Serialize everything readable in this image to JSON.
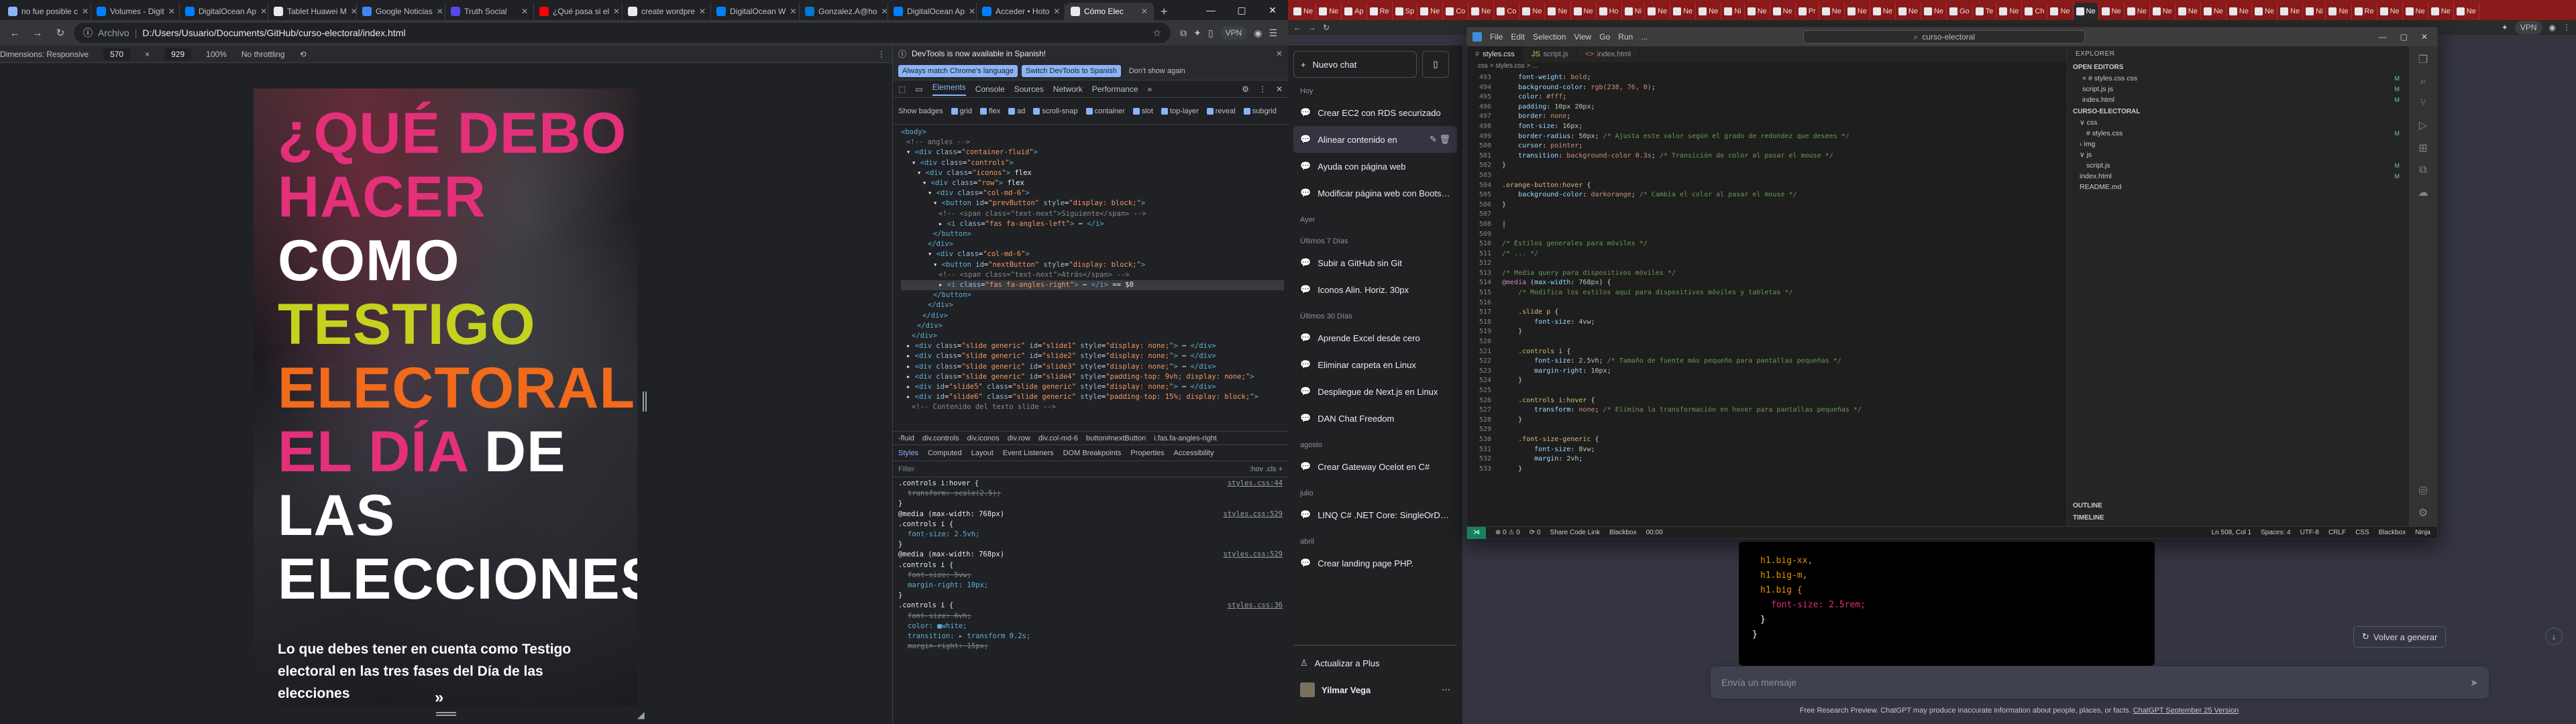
{
  "left_browser": {
    "tabs": [
      {
        "title": "no fue posible c",
        "color": "#8ab4f8"
      },
      {
        "title": "Volumes - Digit",
        "color": "#0080ff"
      },
      {
        "title": "DigitalOcean Ap",
        "color": "#0080ff"
      },
      {
        "title": "Tablet Huawei M",
        "color": "#e8eaed"
      },
      {
        "title": "Google Noticias",
        "color": "#4285f4"
      },
      {
        "title": "Truth Social",
        "color": "#5448ee"
      },
      {
        "title": "¿Qué pasa si el",
        "color": "#ff0000"
      },
      {
        "title": "create wordpre",
        "color": "#e8eaed"
      },
      {
        "title": "DigitalOcean W",
        "color": "#0080ff"
      },
      {
        "title": "Gonzalez.A@ho",
        "color": "#0078d4"
      },
      {
        "title": "DigitalOcean Ap",
        "color": "#0080ff"
      },
      {
        "title": "Acceder • Hoto",
        "color": "#0080ff"
      },
      {
        "title": "Cómo Elec",
        "color": "#e8eaed",
        "active": true
      }
    ],
    "address_prefix": "Archivo",
    "address": "D:/Users/Usuario/Documents/GitHub/curso-electoral/index.html",
    "vpn": "VPN",
    "device_toolbar": {
      "dimensions": "Dimensions: Responsive",
      "width": "570",
      "x": "×",
      "height": "929",
      "zoom": "100%",
      "throttle": "No throttling"
    },
    "page": {
      "headline": [
        {
          "text": "¿QUÉ DEBO",
          "color": "pink"
        },
        {
          "text": "HACER",
          "color": "pink"
        },
        {
          "text": "COMO",
          "color": "white"
        },
        {
          "text": "TESTIGO",
          "color": "lime"
        },
        {
          "text": "ELECTORAL",
          "color": "orange"
        },
        {
          "text_a": "EL DÍA",
          "text_b": " DE",
          "color": "mixed"
        },
        {
          "text": "LAS",
          "color": "white"
        },
        {
          "text": "ELECCIONES",
          "color": "white"
        }
      ],
      "subtitle": "Lo que debes tener en cuenta como Testigo electoral en las tres fases del Día de las elecciones",
      "next_arrow": "»"
    },
    "devtools": {
      "info": "DevTools is now available in Spanish!",
      "btn_always": "Always match Chrome's language",
      "btn_switch": "Switch DevTools to Spanish",
      "btn_dont": "Don't show again",
      "tabs": [
        "Elements",
        "Console",
        "Sources",
        "Network",
        "Performance",
        "»"
      ],
      "badges_label": "Show badges",
      "badges": [
        "grid",
        "flex",
        "ad",
        "scroll-snap",
        "container",
        "slot",
        "top-layer",
        "reveal",
        "subgrid"
      ],
      "dom_lines": [
        {
          "indent": 0,
          "html": "<span class='tag'>&lt;body&gt;</span>"
        },
        {
          "indent": 1,
          "html": "<span class='cmt'>&lt;!-- angles --&gt;</span>"
        },
        {
          "indent": 1,
          "html": "▾ <span class='tag'>&lt;div</span> <span class='attr'>class</span>=<span class='val'>\"container-fluid\"</span><span class='tag'>&gt;</span>"
        },
        {
          "indent": 2,
          "html": "▾ <span class='tag'>&lt;div</span> <span class='attr'>class</span>=<span class='val'>\"controls\"</span><span class='tag'>&gt;</span>"
        },
        {
          "indent": 3,
          "html": "▾ <span class='tag'>&lt;div</span> <span class='attr'>class</span>=<span class='val'>\"iconos\"</span><span class='tag'>&gt;</span> flex"
        },
        {
          "indent": 4,
          "html": "▾ <span class='tag'>&lt;div</span> <span class='attr'>class</span>=<span class='val'>\"row\"</span><span class='tag'>&gt;</span> flex"
        },
        {
          "indent": 5,
          "html": "▾ <span class='tag'>&lt;div</span> <span class='attr'>class</span>=<span class='val'>\"col-md-6\"</span><span class='tag'>&gt;</span>"
        },
        {
          "indent": 6,
          "html": "▾ <span class='tag'>&lt;button</span> <span class='attr'>id</span>=<span class='val'>\"prevButton\"</span> <span class='attr'>style</span>=<span class='val'>\"display: block;\"</span><span class='tag'>&gt;</span>"
        },
        {
          "indent": 7,
          "html": "<span class='cmt'>&lt;!-- &lt;span class=\"text-next\"&gt;Siguiente&lt;/span&gt; --&gt;</span>"
        },
        {
          "indent": 7,
          "html": "▸ <span class='tag'>&lt;i</span> <span class='attr'>class</span>=<span class='val'>\"fas fa-angles-left\"</span><span class='tag'>&gt;</span> ⋯ <span class='tag'>&lt;/i&gt;</span>"
        },
        {
          "indent": 6,
          "html": "<span class='tag'>&lt;/button&gt;</span>"
        },
        {
          "indent": 5,
          "html": "<span class='tag'>&lt;/div&gt;</span>"
        },
        {
          "indent": 5,
          "html": "▾ <span class='tag'>&lt;div</span> <span class='attr'>class</span>=<span class='val'>\"col-md-6\"</span><span class='tag'>&gt;</span>"
        },
        {
          "indent": 6,
          "html": "▾ <span class='tag'>&lt;button</span> <span class='attr'>id</span>=<span class='val'>\"nextButton\"</span> <span class='attr'>style</span>=<span class='val'>\"display: block;\"</span><span class='tag'>&gt;</span>"
        },
        {
          "indent": 7,
          "html": "<span class='cmt'>&lt;!-- &lt;span class=\"text-next\"&gt;Atrás&lt;/span&gt; --&gt;</span>"
        },
        {
          "indent": 7,
          "html": "▸ <span class='tag'>&lt;i</span> <span class='attr'>class</span>=<span class='val'>\"fas fa-angles-right\"</span><span class='tag'>&gt;</span> ⋯ <span class='tag'>&lt;/i&gt;</span> == $0",
          "sel": true
        },
        {
          "indent": 6,
          "html": "<span class='tag'>&lt;/button&gt;</span>"
        },
        {
          "indent": 5,
          "html": "<span class='tag'>&lt;/div&gt;</span>"
        },
        {
          "indent": 4,
          "html": "<span class='tag'>&lt;/div&gt;</span>"
        },
        {
          "indent": 3,
          "html": "<span class='tag'>&lt;/div&gt;</span>"
        },
        {
          "indent": 2,
          "html": "<span class='tag'>&lt;/div&gt;</span>"
        },
        {
          "indent": 1,
          "html": "▸ <span class='tag'>&lt;div</span> <span class='attr'>class</span>=<span class='val'>\"slide generic\"</span> <span class='attr'>id</span>=<span class='val'>\"slide1\"</span> <span class='attr'>style</span>=<span class='val'>\"display: none;\"</span><span class='tag'>&gt;</span> ⋯ <span class='tag'>&lt;/div&gt;</span>"
        },
        {
          "indent": 1,
          "html": "▸ <span class='tag'>&lt;div</span> <span class='attr'>class</span>=<span class='val'>\"slide generic\"</span> <span class='attr'>id</span>=<span class='val'>\"slide2\"</span> <span class='attr'>style</span>=<span class='val'>\"display: none;\"</span><span class='tag'>&gt;</span> ⋯ <span class='tag'>&lt;/div&gt;</span>"
        },
        {
          "indent": 1,
          "html": "▸ <span class='tag'>&lt;div</span> <span class='attr'>class</span>=<span class='val'>\"slide generic\"</span> <span class='attr'>id</span>=<span class='val'>\"slide3\"</span> <span class='attr'>style</span>=<span class='val'>\"display: none;\"</span><span class='tag'>&gt;</span> ⋯ <span class='tag'>&lt;/div&gt;</span>"
        },
        {
          "indent": 1,
          "html": "▸ <span class='tag'>&lt;div</span> <span class='attr'>class</span>=<span class='val'>\"slide generic\"</span> <span class='attr'>id</span>=<span class='val'>\"slide4\"</span> <span class='attr'>style</span>=<span class='val'>\"padding-top: 9vh; display: none;\"</span><span class='tag'>&gt;</span>"
        },
        {
          "indent": 1,
          "html": "▸ <span class='tag'>&lt;div</span> <span class='attr'>id</span>=<span class='val'>\"slide5\"</span> <span class='attr'>class</span>=<span class='val'>\"slide generic\"</span> <span class='attr'>style</span>=<span class='val'>\"display: none;\"</span><span class='tag'>&gt;</span> ⋯ <span class='tag'>&lt;/div&gt;</span>"
        },
        {
          "indent": 1,
          "html": "▸ <span class='tag'>&lt;div</span> <span class='attr'>id</span>=<span class='val'>\"slide6\"</span> <span class='attr'>class</span>=<span class='val'>\"slide generic\"</span> <span class='attr'>style</span>=<span class='val'>\"padding-top: 15%; display: block;\"</span><span class='tag'>&gt;</span>"
        },
        {
          "indent": 2,
          "html": "<span class='cmt'>&lt;!-- Contenido del texto slide --&gt;</span>"
        }
      ],
      "breadcrumb": [
        "-fluid",
        "div.controls",
        "div.iconos",
        "div.row",
        "div.col-md-6",
        "button#nextButton",
        "i.fas.fa-angles-right"
      ],
      "style_tabs": [
        "Styles",
        "Computed",
        "Layout",
        "Event Listeners",
        "DOM Breakpoints",
        "Properties",
        "Accessibility"
      ],
      "filter_placeholder": "Filter",
      "filter_tools": ":hov  .cls  +",
      "style_rules": [
        {
          "sel": ".controls i:hover {",
          "src": "styles.css:44"
        },
        {
          "decl": "transform: scale(2.5);",
          "strike": true
        },
        {
          "close": "}"
        },
        {
          "sel": "@media (max-width: 768px)",
          "src": "styles.css:529"
        },
        {
          "sel": ".controls i {",
          "src": ""
        },
        {
          "decl": "font-size: 2.5vh;",
          "strike": false
        },
        {
          "close": "}"
        },
        {
          "sel": "@media (max-width: 768px)",
          "src": "styles.css:529"
        },
        {
          "sel": ".controls i {",
          "src": ""
        },
        {
          "decl": "font-size: 5vw;",
          "strike": true
        },
        {
          "decl": "margin-right: 10px;",
          "strike": false
        },
        {
          "close": "}"
        },
        {
          "sel": ".controls i {",
          "src": "styles.css:36"
        },
        {
          "decl": "font-size: 6vh;",
          "strike": true
        },
        {
          "decl": "color: ■white;",
          "strike": false
        },
        {
          "decl": "transition: ▸ transform 0.2s;",
          "strike": false
        },
        {
          "decl": "margin-right: 15px;",
          "strike": true
        }
      ]
    }
  },
  "right_browser": {
    "tab_labels": [
      "Ne",
      "Ne",
      "Ap",
      "Re",
      "Sp",
      "Ne",
      "Co",
      "Ne",
      "Co",
      "Ne",
      "Ne",
      "Ne",
      "Ho",
      "Ni",
      "Ne",
      "Ne",
      "Ne",
      "Ni",
      "Ne",
      "Ne",
      "Pr",
      "Ne",
      "Ne",
      "Ne",
      "Ne",
      "Ne",
      "Go",
      "Te",
      "Ne",
      "Ch",
      "Ne",
      "Ne",
      "Ne",
      "Ne",
      "Ne",
      "Ne",
      "Ne",
      "Ne",
      "Ne",
      "Ne",
      "Ni",
      "Ne",
      "Re",
      "Ne",
      "Ne",
      "Ne",
      "Ne"
    ],
    "vpn": "VPN",
    "chatgpt": {
      "new_chat": "Nuevo chat",
      "groups": [
        {
          "label": "Hoy",
          "items": [
            "Crear EC2 con RDS securizado",
            "Alinear contenido en",
            "Ayuda con página web",
            "Modificar página web con Bootstrap"
          ]
        },
        {
          "label": "Ayer",
          "items": []
        },
        {
          "label": "Últimos 7 Días",
          "items": [
            "Subir a GitHub sin Git",
            "Iconos Alin. Horiz. 30px"
          ]
        },
        {
          "label": "Últimos 30 Días",
          "items": [
            "Aprende Excel desde cero",
            "Eliminar carpeta en Linux",
            "Despliegue de Next.js en Linux",
            "DAN Chat Freedom"
          ]
        },
        {
          "label": "agosto",
          "items": [
            "Crear Gateway Ocelot en C#"
          ]
        },
        {
          "label": "julio",
          "items": [
            "LINQ C# .NET Core: SingleOrDefault"
          ]
        },
        {
          "label": "abril",
          "items": [
            "Crear landing page PHP."
          ]
        }
      ],
      "upgrade": "Actualizar a Plus",
      "user": "Yilmar Vega",
      "code_lines": [
        "h1.big-xx,",
        "h1.big-m,",
        "h1.big {",
        "font-size: 2.5rem;",
        "}",
        "}"
      ],
      "regenerate": "Volver a generar",
      "input_placeholder": "Envía un mensaje",
      "footer_text": "Free Research Preview. ChatGPT may produce inaccurate information about people, places, or facts.",
      "footer_link": "ChatGPT September 25 Version"
    },
    "vscode": {
      "menu": [
        "File",
        "Edit",
        "Selection",
        "View",
        "Go",
        "Run",
        "..."
      ],
      "search": "curso-electoral",
      "tabs": [
        {
          "name": "styles.css",
          "kind": "css",
          "active": true
        },
        {
          "name": "script.js",
          "kind": "js"
        },
        {
          "name": "index.html",
          "kind": "html"
        }
      ],
      "crumb": "css > styles.css > ...",
      "lines": [
        {
          "n": "493",
          "c": "<span class='s-prop'>    font-weight</span>: <span class='s-val'>bold</span>;"
        },
        {
          "n": "494",
          "c": "<span class='s-prop'>    background-color</span>: <span class='s-val'>rgb(238, 76, 0)</span>;"
        },
        {
          "n": "495",
          "c": "<span class='s-prop'>    color</span>: <span class='s-val'>#fff</span>;"
        },
        {
          "n": "496",
          "c": "<span class='s-prop'>    padding</span>: <span class='s-num'>10px 20px</span>;"
        },
        {
          "n": "497",
          "c": "<span class='s-prop'>    border</span>: <span class='s-val'>none</span>;"
        },
        {
          "n": "498",
          "c": "<span class='s-prop'>    font-size</span>: <span class='s-num'>16px</span>;"
        },
        {
          "n": "499",
          "c": "<span class='s-prop'>    border-radius</span>: <span class='s-num'>50px</span>; <span class='s-cmt'>/* Ajusta este valor según el grado de redondez que desees */</span>"
        },
        {
          "n": "500",
          "c": "<span class='s-prop'>    cursor</span>: <span class='s-val'>pointer</span>;"
        },
        {
          "n": "501",
          "c": "<span class='s-prop'>    transition</span>: <span class='s-val'>background-color 0.3s</span>; <span class='s-cmt'>/* Transición de color al pasar el mouse */</span>"
        },
        {
          "n": "502",
          "c": "}"
        },
        {
          "n": "503",
          "c": ""
        },
        {
          "n": "504",
          "c": "<span class='s-sel'>.orange-button:hover</span> {"
        },
        {
          "n": "505",
          "c": "<span class='s-prop'>    background-color</span>: <span class='s-val'>darkorange</span>; <span class='s-cmt'>/* Cambia el color al pasar el mouse */</span>"
        },
        {
          "n": "506",
          "c": "}"
        },
        {
          "n": "507",
          "c": ""
        },
        {
          "n": "508",
          "c": "|"
        },
        {
          "n": "509",
          "c": ""
        },
        {
          "n": "510",
          "c": "<span class='s-cmt'>/* Estilos generales para móviles */</span>"
        },
        {
          "n": "511",
          "c": "<span class='s-cmt'>/* ... */</span>"
        },
        {
          "n": "512",
          "c": ""
        },
        {
          "n": "513",
          "c": "<span class='s-cmt'>/* Media query para dispositivos móviles */</span>"
        },
        {
          "n": "514",
          "c": "<span class='s-at'>@media</span> (<span class='s-prop'>max-width</span>: <span class='s-num'>768px</span>) {"
        },
        {
          "n": "515",
          "c": "<span class='s-cmt'>    /* Modifica los estilos aquí para dispositivos móviles y tabletas */</span>"
        },
        {
          "n": "516",
          "c": ""
        },
        {
          "n": "517",
          "c": "<span class='s-sel'>    .slide p</span> {"
        },
        {
          "n": "518",
          "c": "<span class='s-prop'>        font-size</span>: <span class='s-num'>4vw</span>;"
        },
        {
          "n": "519",
          "c": "    }"
        },
        {
          "n": "520",
          "c": ""
        },
        {
          "n": "521",
          "c": "<span class='s-sel'>    .controls i</span> {"
        },
        {
          "n": "522",
          "c": "<span class='s-prop'>        font-size</span>: <span class='s-num'>2.5vh</span>; <span class='s-cmt'>/* Tamaño de fuente más pequeño para pantallas pequeñas */</span>"
        },
        {
          "n": "523",
          "c": "<span class='s-prop'>        margin-right</span>: <span class='s-num'>10px</span>;"
        },
        {
          "n": "524",
          "c": "    }"
        },
        {
          "n": "525",
          "c": ""
        },
        {
          "n": "526",
          "c": "<span class='s-sel'>    .controls i:hover</span> {"
        },
        {
          "n": "527",
          "c": "<span class='s-prop'>        transform</span>: <span class='s-val'>none</span>; <span class='s-cmt'>/* Elimina la transformación en hover para pantallas pequeñas */</span>"
        },
        {
          "n": "528",
          "c": "    }"
        },
        {
          "n": "529",
          "c": ""
        },
        {
          "n": "530",
          "c": "<span class='s-sel'>    .font-size-generic</span> {"
        },
        {
          "n": "531",
          "c": "<span class='s-prop'>        font-size</span>: <span class='s-num'>8vw</span>;"
        },
        {
          "n": "532",
          "c": "<span class='s-prop'>        margin</span>: <span class='s-num'>2vh</span>;"
        },
        {
          "n": "533",
          "c": "    }"
        }
      ],
      "explorer": {
        "header": "EXPLORER",
        "open_editors": "OPEN EDITORS",
        "open_items": [
          {
            "name": "× # styles.css css",
            "m": "M"
          },
          {
            "name": "script.js js",
            "m": "M"
          },
          {
            "name": "index.html",
            "m": "M"
          }
        ],
        "project": "CURSO-ELECTORAL",
        "tree": [
          {
            "name": "∨ css",
            "m": "",
            "indent": 1
          },
          {
            "name": "# styles.css",
            "m": "M",
            "indent": 2
          },
          {
            "name": "› img",
            "m": "",
            "indent": 1
          },
          {
            "name": "∨ js",
            "m": "",
            "indent": 1
          },
          {
            "name": "script.js",
            "m": "M",
            "indent": 2
          },
          {
            "name": "index.html",
            "m": "M",
            "indent": 1
          },
          {
            "name": "README.md",
            "m": "",
            "indent": 1
          }
        ],
        "outline": "OUTLINE",
        "timeline": "TIMELINE"
      },
      "status": {
        "left": [
          "⊗ 0 ⚠ 0",
          "⟳ 0",
          "Share Code Link",
          "Blackbox",
          "00:00"
        ],
        "right": [
          "Ln 508, Col 1",
          "Spaces: 4",
          "UTF-8",
          "CRLF",
          "CSS",
          "Blackbox",
          "Ninja"
        ]
      }
    }
  }
}
